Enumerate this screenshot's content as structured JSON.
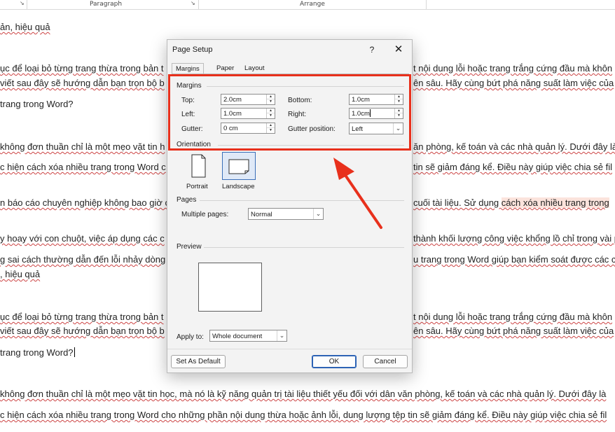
{
  "ribbon": {
    "paragraph_label": "Paragraph",
    "arrange_label": "Arrange",
    "launcher_glyph": "↘"
  },
  "document": {
    "lines": [
      {
        "text": "ản, hiệu quả"
      },
      {
        "text": "ục để loại bỏ từng trang thừa trong bản t"
      },
      {
        "text": "t nội dung lỗi hoặc trang trắng cứng đầu mà khôn"
      },
      {
        "text": "viết sau đây sẽ hướng dẫn bạn trọn bộ b"
      },
      {
        "text": "ên sâu. Hãy cùng bứt phá năng suất làm việc của"
      },
      {
        "text": "trang trong Word?"
      },
      {
        "text": "không đơn thuần chỉ là một mẹo vặt tin h"
      },
      {
        "text": "ăn phòng, kế toán và các nhà quản lý. Dưới đây là"
      },
      {
        "text": "c hiện cách xóa nhiều trang trong Word c"
      },
      {
        "text": "tin sẽ giảm đáng kể. Điều này giúp việc chia sẻ fil"
      },
      {
        "text": "n báo cáo chuyên nghiệp không bao giờ c"
      },
      {
        "text": "cuối tài liệu. Sử dụng "
      },
      {
        "text": "cách xóa nhiều trang trong"
      },
      {
        "text": "y hoay với con chuột, việc áp dụng các c"
      },
      {
        "text": "thành khối lượng công việc khổng lồ chỉ trong vài p"
      },
      {
        "text": "g sai cách thường dẫn đến lỗi nhảy dòng"
      },
      {
        "text": "u trang trong Word giúp bạn kiểm soát được các c"
      },
      {
        "text": ", hiệu quả"
      },
      {
        "text": "ục để loại bỏ từng trang thừa trong bản t"
      },
      {
        "text": "t nội dung lỗi hoặc trang trắng cứng đầu mà khôn"
      },
      {
        "text": "viết sau đây sẽ hướng dẫn bạn trọn bộ b"
      },
      {
        "text": "ên sâu. Hãy cùng bứt phá năng suất làm việc của"
      },
      {
        "text": "trang trong Word?"
      },
      {
        "text": "không đơn thuần chỉ là một mẹo vặt tin học, mà nó là kỹ năng quản trị tài liệu thiết yếu đối với dân văn phòng, kế toán và các nhà quản lý. Dưới đây là"
      },
      {
        "text": "c hiện cách xóa nhiều trang trong Word cho những phần nội dung thừa hoặc ảnh lỗi, dung lượng tệp tin sẽ giảm đáng kể. Điều này giúp việc chia sẻ fil"
      }
    ]
  },
  "dialog": {
    "title": "Page Setup",
    "help_glyph": "?",
    "close_glyph": "✕",
    "tabs": [
      {
        "label": "Margins",
        "active": true
      },
      {
        "label": "Paper",
        "active": false
      },
      {
        "label": "Layout",
        "active": false
      }
    ],
    "margins": {
      "group_label": "Margins",
      "top_label": "Top:",
      "top_value": "2.0cm",
      "bottom_label": "Bottom:",
      "bottom_value": "1.0cm",
      "left_label": "Left:",
      "left_value": "1.0cm",
      "right_label": "Right:",
      "right_value": "1.0cm",
      "gutter_label": "Gutter:",
      "gutter_value": "0 cm",
      "gutter_position_label": "Gutter position:",
      "gutter_position_value": "Left"
    },
    "orientation": {
      "group_label": "Orientation",
      "portrait_label": "Portrait",
      "landscape_label": "Landscape",
      "selected": "Landscape"
    },
    "pages": {
      "group_label": "Pages",
      "multiple_pages_label": "Multiple pages:",
      "multiple_pages_value": "Normal"
    },
    "preview": {
      "group_label": "Preview"
    },
    "apply_to_label": "Apply to:",
    "apply_to_value": "Whole document",
    "set_default_label": "Set As Default",
    "ok_label": "OK",
    "cancel_label": "Cancel"
  },
  "annotation": {
    "color": "#e8301c"
  }
}
